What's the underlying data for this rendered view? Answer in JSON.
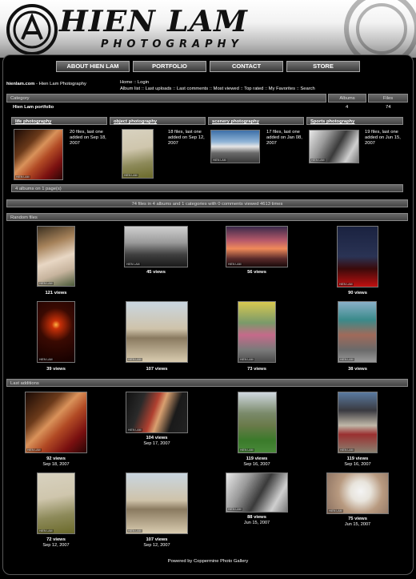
{
  "header": {
    "brand": "HIEN LAM",
    "brand_sub": "PHOTOGRAPHY"
  },
  "nav": [
    "ABOUT HIEN LAM",
    "PORTFOLIO",
    "CONTACT",
    "STORE"
  ],
  "site": {
    "title": "hienlam.com",
    "subtitle": " - Hien Lam Photography"
  },
  "links": {
    "line1": "Home :: Login",
    "line2": "Album list :: Last uploads :: Last comments :: Most viewed :: Top rated :: My Favorites :: Search"
  },
  "table": {
    "category": "Category",
    "albums": "Albums",
    "files": "Files",
    "row_name": "Hien Lam portfolio",
    "row_albums": "4",
    "row_files": "74"
  },
  "albums": [
    {
      "title": "life photography",
      "info": "20 files, last one added on Sep 18, 2007"
    },
    {
      "title": "object photography",
      "info": "18 files, last one added on Sep 12, 2007"
    },
    {
      "title": "scenery photography",
      "info": "17 files, last one added on Jan 08, 2007"
    },
    {
      "title": "Sports photography",
      "info": "19 files, last one added on Jun 15, 2007"
    }
  ],
  "albums_footer": "4 albums on 1 page(s)",
  "stats": "74 files in 4 albums and 1 categories with 0 comments viewed 4613 times",
  "random": {
    "title": "Random files",
    "items": [
      {
        "views": "121 views"
      },
      {
        "views": "45 views"
      },
      {
        "views": "56 views"
      },
      {
        "views": "90 views"
      },
      {
        "views": "39 views"
      },
      {
        "views": "107 views"
      },
      {
        "views": "73 views"
      },
      {
        "views": "38 views"
      }
    ]
  },
  "last": {
    "title": "Last additions",
    "items": [
      {
        "views": "92 views",
        "date": "Sep 18, 2007"
      },
      {
        "views": "104 views",
        "date": "Sep 17, 2007"
      },
      {
        "views": "119 views",
        "date": "Sep 16, 2007"
      },
      {
        "views": "119 views",
        "date": "Sep 16, 2007"
      },
      {
        "views": "72 views",
        "date": "Sep 12, 2007"
      },
      {
        "views": "107 views",
        "date": "Sep 12, 2007"
      },
      {
        "views": "88 views",
        "date": "Jun 15, 2007"
      },
      {
        "views": "75 views",
        "date": "Jun 15, 2007"
      }
    ]
  },
  "watermark": "HIEN LAM",
  "footer": "Powered by Coppermine Photo Gallery"
}
